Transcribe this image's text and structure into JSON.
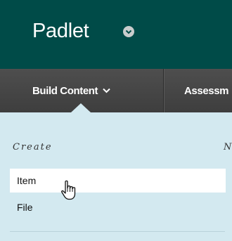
{
  "header": {
    "app_title": "Padlet"
  },
  "tabs": [
    {
      "label": "Build Content"
    },
    {
      "label": "Assessm"
    }
  ],
  "menu": {
    "heading": "Create",
    "heading_right": "N",
    "items": [
      {
        "label": "Item"
      },
      {
        "label": "File"
      }
    ]
  },
  "colors": {
    "header_bg": "#004b48",
    "tabbar_bg": "#444444",
    "menu_bg": "#d3e9f0",
    "active_item_bg": "#ffffff"
  },
  "icons": [
    "chevron-down-circle-icon",
    "chevron-down-icon",
    "hand-pointer-cursor-icon"
  ]
}
